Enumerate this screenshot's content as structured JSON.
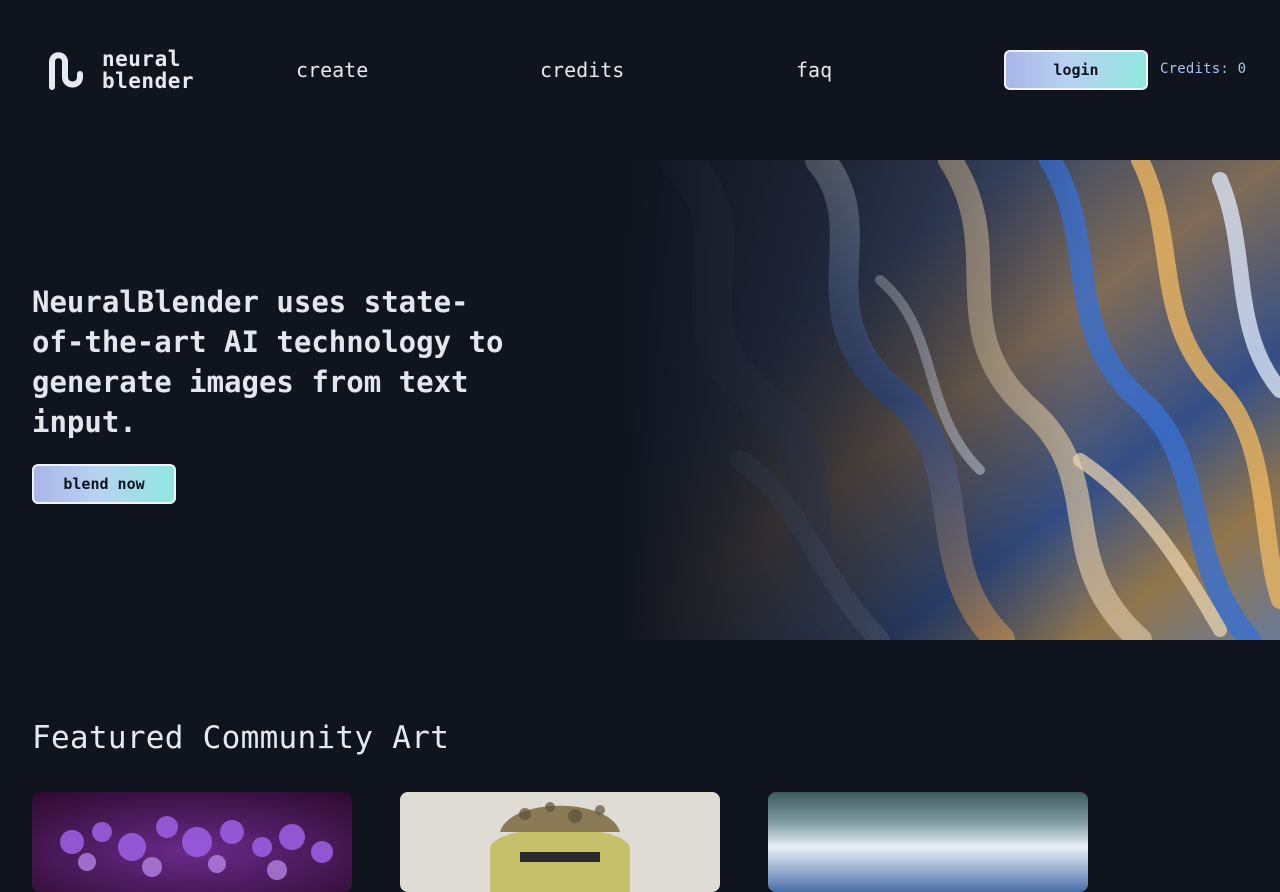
{
  "brand": {
    "line1": "neural",
    "line2": "blender",
    "logo_icon": "n-loop-logo-icon"
  },
  "nav": {
    "create": "create",
    "credits": "credits",
    "faq": "faq"
  },
  "header": {
    "login_label": "login",
    "credits_text": "Credits: 0"
  },
  "hero": {
    "headline": "NeuralBlender uses state-of-the-art AI technology to generate images from text input.",
    "cta_label": "blend now",
    "art_description_icon": "iridescent-swirl-image"
  },
  "featured": {
    "title": "Featured Community Art",
    "cards": [
      {
        "icon": "purple-coral-image"
      },
      {
        "icon": "camo-hat-figure-image"
      },
      {
        "icon": "misty-water-image"
      }
    ]
  },
  "colors": {
    "background": "#10141f",
    "button_gradient_start": "#a9b6e8",
    "button_gradient_end": "#8fe7df",
    "credits_text": "#a8c3e8"
  }
}
